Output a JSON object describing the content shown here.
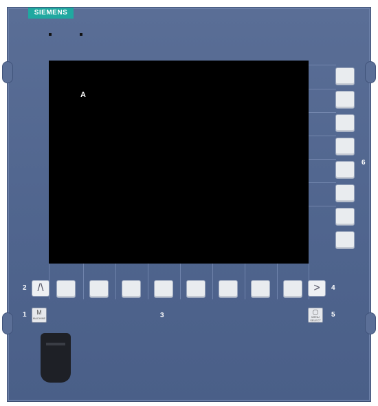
{
  "brand": "SIEMENS",
  "screen": {
    "label": "A"
  },
  "callouts": {
    "n1": "1",
    "n2": "2",
    "n3": "3",
    "n4": "4",
    "n5": "5",
    "n6": "6"
  },
  "keys": {
    "recall_symbol": "/\\",
    "next_symbol": ">",
    "machine_key": {
      "glyph": "M",
      "text": "MACHINE"
    },
    "menu_select_key": {
      "glyph": "◯",
      "text": "MENU SELECT"
    }
  }
}
